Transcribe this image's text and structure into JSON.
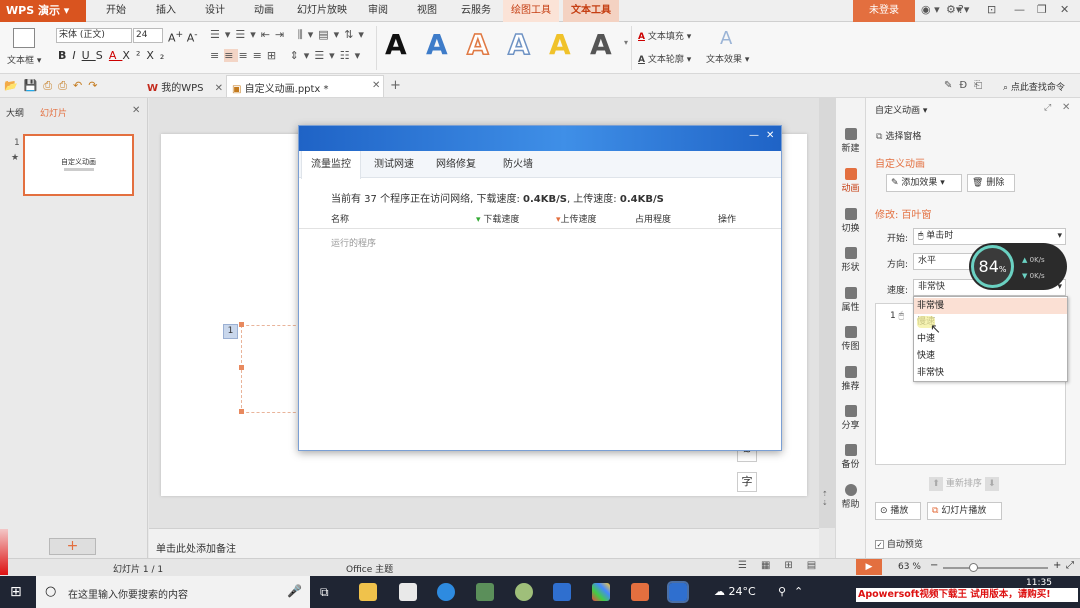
{
  "app": {
    "name": "WPS 演示"
  },
  "menu": [
    "开始",
    "插入",
    "设计",
    "动画",
    "幻灯片放映",
    "审阅",
    "视图",
    "云服务"
  ],
  "context_tabs": {
    "draw": "绘图工具",
    "text": "文本工具"
  },
  "login_label": "未登录",
  "ribbon": {
    "textbox_label": "文本框",
    "font_name": "宋体 (正文)",
    "font_size": "24",
    "text_fill": "文本填充",
    "text_outline": "文本轮廓",
    "text_effect": "文本效果",
    "style_colors": [
      "#111111",
      "#3e7cc9",
      "#e07a45",
      "#9bb4d6",
      "#f0c22a",
      "#555555"
    ]
  },
  "doc_tabs": {
    "my_wps": "我的WPS",
    "file": "自定义动画.pptx *"
  },
  "search_cmd": "点此查找命令",
  "left_panel": {
    "tab_outline": "大纲",
    "tab_slides": "幻灯片",
    "slide_number": "1",
    "thumb_title": "自定义动画"
  },
  "slide": {
    "anim_tag": "1"
  },
  "notes_placeholder": "单击此处添加备注",
  "dialog": {
    "tabs": [
      "流量监控",
      "测试网速",
      "网络修复",
      "防火墙"
    ],
    "info_pre": "当前有 37 个程序正在访问网络, 下载速度: ",
    "download": "0.4KB/S",
    "info_mid": ", 上传速度: ",
    "upload": "0.4KB/S",
    "col_name": "名称",
    "col_down": "下载速度",
    "col_up": "上传速度",
    "col_share": "占用程度",
    "col_action": "操作",
    "row_running": "运行的程序"
  },
  "sidebar": [
    "新建",
    "动画",
    "切换",
    "形状",
    "属性",
    "传图",
    "推荐",
    "分享",
    "备份",
    "帮助"
  ],
  "task_pane": {
    "title": "自定义动画",
    "select_pane": "选择窗格",
    "section": "自定义动画",
    "add_effect": "添加效果",
    "delete": "删除",
    "modify_label": "修改: 百叶窗",
    "start_label": "开始:",
    "start_value": "单击时",
    "direction_label": "方向:",
    "direction_value": "水平",
    "speed_label": "速度:",
    "speed_value": "非常快",
    "speed_options": [
      "非常慢",
      "慢速",
      "中速",
      "快速",
      "非常快"
    ],
    "list_index": "1",
    "reorder": "重新排序",
    "play": "播放",
    "slideshow": "幻灯片播放",
    "auto_preview": "自动预览"
  },
  "speed_widget": {
    "percent": "84",
    "unit": "%",
    "up": "0K/s",
    "down": "0K/s"
  },
  "status": {
    "slide": "幻灯片 1 / 1",
    "theme": "Office 主题",
    "zoom": "63 %"
  },
  "taskbar": {
    "search": "在这里输入你要搜索的内容",
    "weather": "24°C",
    "time": "11:35"
  },
  "watermark": "Apowersoft视频下载王 试用版本，请购买!"
}
